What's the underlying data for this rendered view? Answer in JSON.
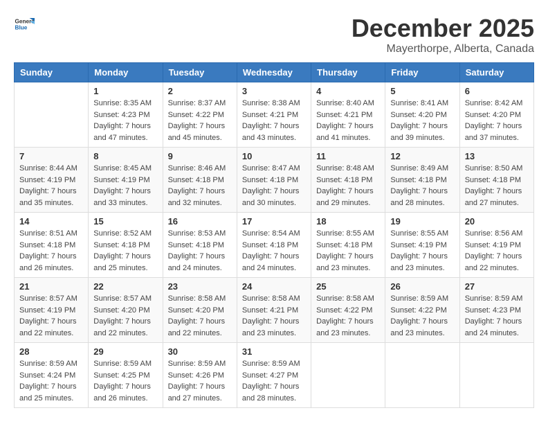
{
  "header": {
    "logo_general": "General",
    "logo_blue": "Blue",
    "month_title": "December 2025",
    "location": "Mayerthorpe, Alberta, Canada"
  },
  "weekdays": [
    "Sunday",
    "Monday",
    "Tuesday",
    "Wednesday",
    "Thursday",
    "Friday",
    "Saturday"
  ],
  "weeks": [
    [
      {
        "day": "",
        "info": ""
      },
      {
        "day": "1",
        "info": "Sunrise: 8:35 AM\nSunset: 4:23 PM\nDaylight: 7 hours\nand 47 minutes."
      },
      {
        "day": "2",
        "info": "Sunrise: 8:37 AM\nSunset: 4:22 PM\nDaylight: 7 hours\nand 45 minutes."
      },
      {
        "day": "3",
        "info": "Sunrise: 8:38 AM\nSunset: 4:21 PM\nDaylight: 7 hours\nand 43 minutes."
      },
      {
        "day": "4",
        "info": "Sunrise: 8:40 AM\nSunset: 4:21 PM\nDaylight: 7 hours\nand 41 minutes."
      },
      {
        "day": "5",
        "info": "Sunrise: 8:41 AM\nSunset: 4:20 PM\nDaylight: 7 hours\nand 39 minutes."
      },
      {
        "day": "6",
        "info": "Sunrise: 8:42 AM\nSunset: 4:20 PM\nDaylight: 7 hours\nand 37 minutes."
      }
    ],
    [
      {
        "day": "7",
        "info": "Sunrise: 8:44 AM\nSunset: 4:19 PM\nDaylight: 7 hours\nand 35 minutes."
      },
      {
        "day": "8",
        "info": "Sunrise: 8:45 AM\nSunset: 4:19 PM\nDaylight: 7 hours\nand 33 minutes."
      },
      {
        "day": "9",
        "info": "Sunrise: 8:46 AM\nSunset: 4:18 PM\nDaylight: 7 hours\nand 32 minutes."
      },
      {
        "day": "10",
        "info": "Sunrise: 8:47 AM\nSunset: 4:18 PM\nDaylight: 7 hours\nand 30 minutes."
      },
      {
        "day": "11",
        "info": "Sunrise: 8:48 AM\nSunset: 4:18 PM\nDaylight: 7 hours\nand 29 minutes."
      },
      {
        "day": "12",
        "info": "Sunrise: 8:49 AM\nSunset: 4:18 PM\nDaylight: 7 hours\nand 28 minutes."
      },
      {
        "day": "13",
        "info": "Sunrise: 8:50 AM\nSunset: 4:18 PM\nDaylight: 7 hours\nand 27 minutes."
      }
    ],
    [
      {
        "day": "14",
        "info": "Sunrise: 8:51 AM\nSunset: 4:18 PM\nDaylight: 7 hours\nand 26 minutes."
      },
      {
        "day": "15",
        "info": "Sunrise: 8:52 AM\nSunset: 4:18 PM\nDaylight: 7 hours\nand 25 minutes."
      },
      {
        "day": "16",
        "info": "Sunrise: 8:53 AM\nSunset: 4:18 PM\nDaylight: 7 hours\nand 24 minutes."
      },
      {
        "day": "17",
        "info": "Sunrise: 8:54 AM\nSunset: 4:18 PM\nDaylight: 7 hours\nand 24 minutes."
      },
      {
        "day": "18",
        "info": "Sunrise: 8:55 AM\nSunset: 4:18 PM\nDaylight: 7 hours\nand 23 minutes."
      },
      {
        "day": "19",
        "info": "Sunrise: 8:55 AM\nSunset: 4:19 PM\nDaylight: 7 hours\nand 23 minutes."
      },
      {
        "day": "20",
        "info": "Sunrise: 8:56 AM\nSunset: 4:19 PM\nDaylight: 7 hours\nand 22 minutes."
      }
    ],
    [
      {
        "day": "21",
        "info": "Sunrise: 8:57 AM\nSunset: 4:19 PM\nDaylight: 7 hours\nand 22 minutes."
      },
      {
        "day": "22",
        "info": "Sunrise: 8:57 AM\nSunset: 4:20 PM\nDaylight: 7 hours\nand 22 minutes."
      },
      {
        "day": "23",
        "info": "Sunrise: 8:58 AM\nSunset: 4:20 PM\nDaylight: 7 hours\nand 22 minutes."
      },
      {
        "day": "24",
        "info": "Sunrise: 8:58 AM\nSunset: 4:21 PM\nDaylight: 7 hours\nand 23 minutes."
      },
      {
        "day": "25",
        "info": "Sunrise: 8:58 AM\nSunset: 4:22 PM\nDaylight: 7 hours\nand 23 minutes."
      },
      {
        "day": "26",
        "info": "Sunrise: 8:59 AM\nSunset: 4:22 PM\nDaylight: 7 hours\nand 23 minutes."
      },
      {
        "day": "27",
        "info": "Sunrise: 8:59 AM\nSunset: 4:23 PM\nDaylight: 7 hours\nand 24 minutes."
      }
    ],
    [
      {
        "day": "28",
        "info": "Sunrise: 8:59 AM\nSunset: 4:24 PM\nDaylight: 7 hours\nand 25 minutes."
      },
      {
        "day": "29",
        "info": "Sunrise: 8:59 AM\nSunset: 4:25 PM\nDaylight: 7 hours\nand 26 minutes."
      },
      {
        "day": "30",
        "info": "Sunrise: 8:59 AM\nSunset: 4:26 PM\nDaylight: 7 hours\nand 27 minutes."
      },
      {
        "day": "31",
        "info": "Sunrise: 8:59 AM\nSunset: 4:27 PM\nDaylight: 7 hours\nand 28 minutes."
      },
      {
        "day": "",
        "info": ""
      },
      {
        "day": "",
        "info": ""
      },
      {
        "day": "",
        "info": ""
      }
    ]
  ]
}
